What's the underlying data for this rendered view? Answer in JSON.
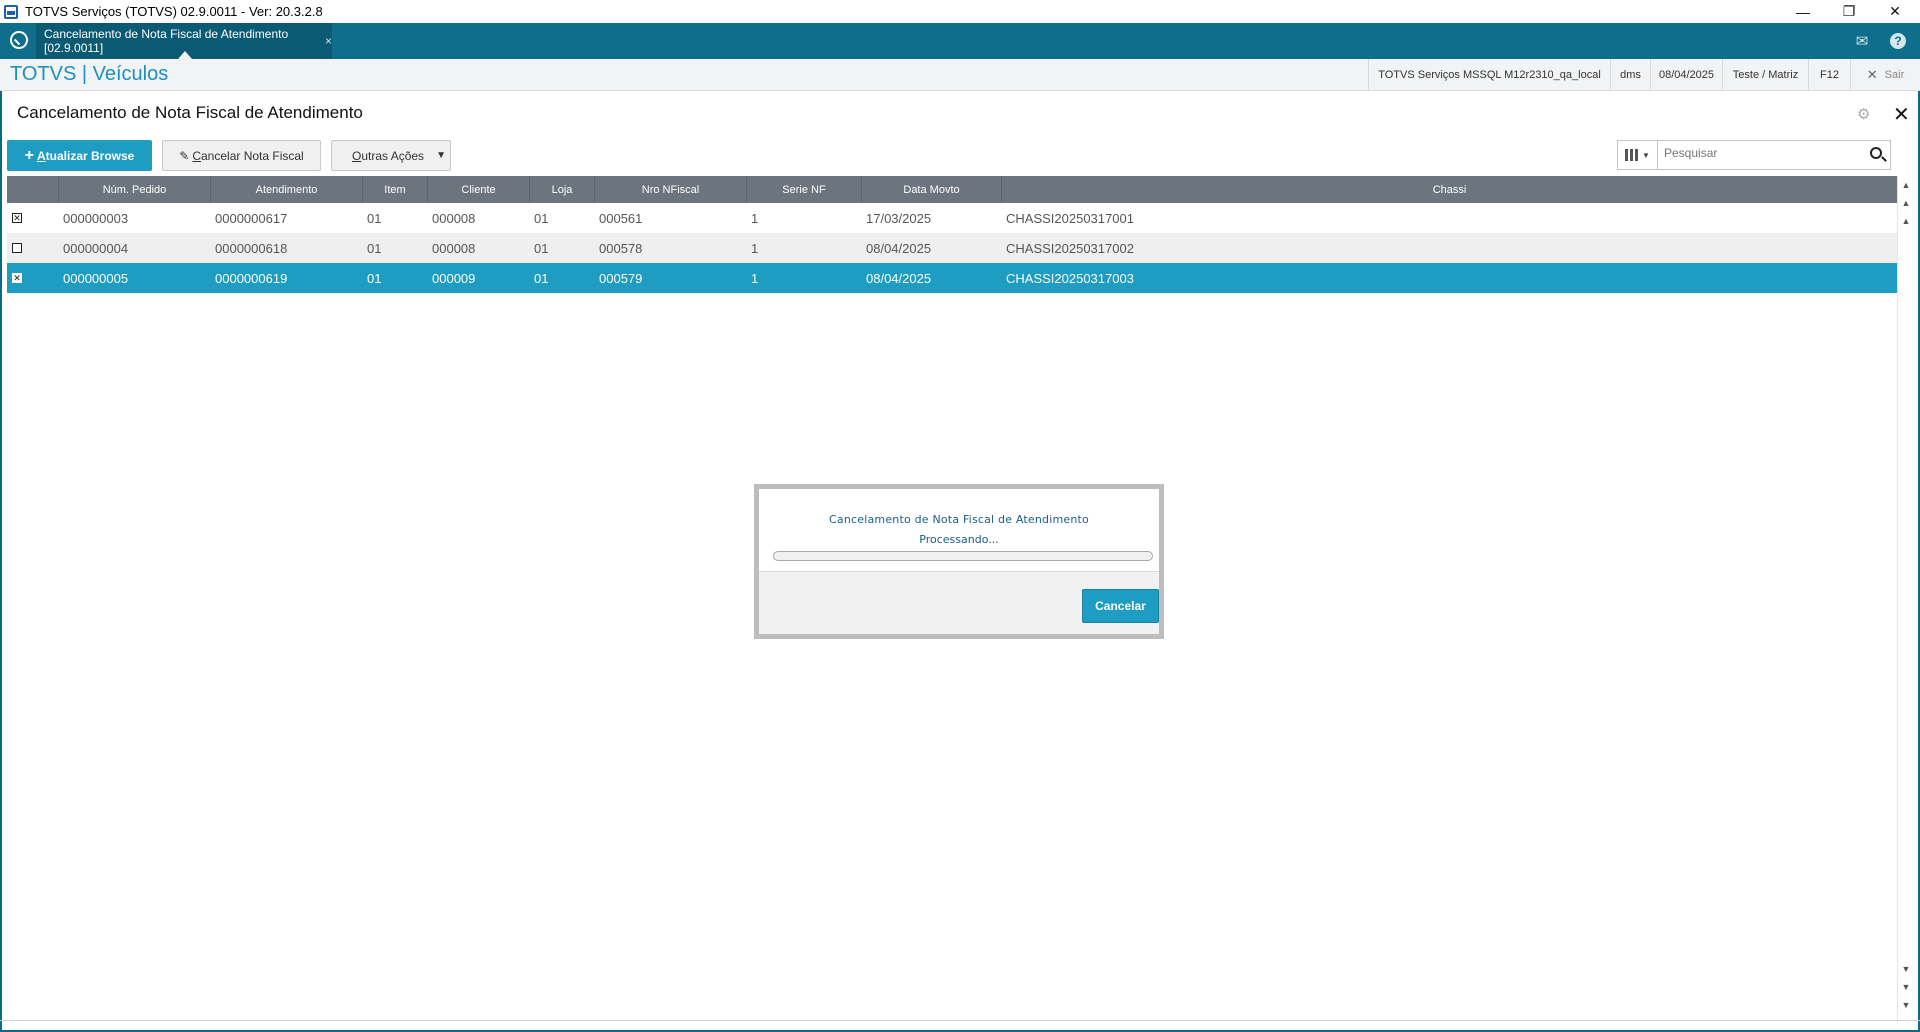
{
  "window": {
    "title": "TOTVS Serviços (TOTVS) 02.9.0011 - Ver: 20.3.2.8",
    "controls": {
      "minimize": "—",
      "restore": "❐",
      "close": "✕"
    }
  },
  "tabbar": {
    "active_tab": "Cancelamento de Nota Fiscal de Atendimento [02.9.0011]",
    "tab_close": "×",
    "mail_icon": "✉",
    "help_icon": "?"
  },
  "header": {
    "brand": "TOTVS | Veículos",
    "environment": "TOTVS Serviços MSSQL M12r2310_qa_local",
    "user": "dms",
    "date": "08/04/2025",
    "company": "Teste / Matriz",
    "shortcut": "F12",
    "exit_label": "Sair"
  },
  "page": {
    "title": "Cancelamento de Nota Fiscal de Atendimento"
  },
  "toolbar": {
    "refresh_label": "Atualizar Browse",
    "refresh_accel": "A",
    "cancel_nf_label": "Cancelar Nota Fiscal",
    "cancel_nf_accel": "C",
    "more_label": "Outras Ações",
    "more_accel": "O",
    "search_placeholder": "Pesquisar"
  },
  "grid": {
    "columns": [
      "Núm. Pedido",
      "Atendimento",
      "Item",
      "Cliente",
      "Loja",
      "Nro NFiscal",
      "Serie NF",
      "Data Movto",
      "Chassi"
    ],
    "rows": [
      {
        "checked": true,
        "cells": [
          "000000003",
          "0000000617",
          "01",
          "000008",
          "01",
          "000561",
          "1",
          "17/03/2025",
          "CHASSI20250317001"
        ]
      },
      {
        "checked": false,
        "cells": [
          "000000004",
          "0000000618",
          "01",
          "000008",
          "01",
          "000578",
          "1",
          "08/04/2025",
          "CHASSI20250317002"
        ]
      },
      {
        "checked": true,
        "cells": [
          "000000005",
          "0000000619",
          "01",
          "000009",
          "01",
          "000579",
          "1",
          "08/04/2025",
          "CHASSI20250317003"
        ]
      }
    ],
    "selected_row_index": 2
  },
  "dialog": {
    "title": "Cancelamento de Nota Fiscal de Atendimento",
    "status": "Processando...",
    "progress": 0,
    "cancel_label": "Cancelar"
  },
  "colors": {
    "accent": "#1e9cc1",
    "tabbar": "#0e6e8b",
    "grid_header": "#6c757d"
  }
}
